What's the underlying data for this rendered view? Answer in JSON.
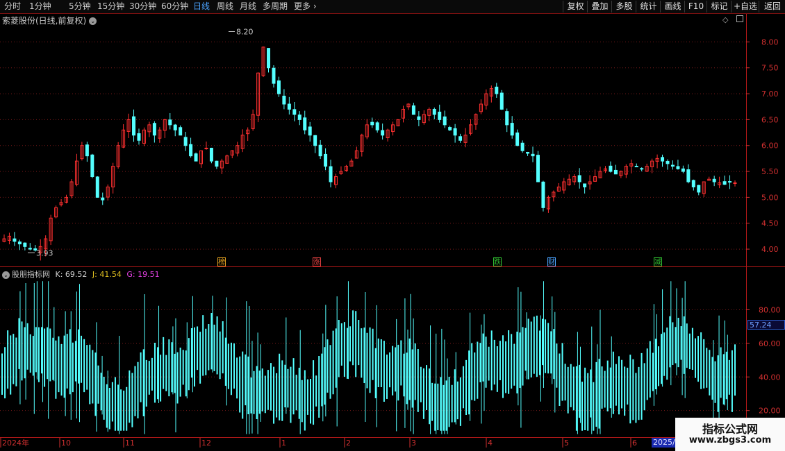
{
  "toolbar": {
    "periods": [
      "分时",
      "1分钟",
      "5分钟",
      "15分钟",
      "30分钟",
      "60分钟",
      "日线",
      "周线",
      "月线",
      "多周期",
      "更多"
    ],
    "active_period": "日线",
    "right_buttons": [
      "复权",
      "叠加",
      "多股",
      "统计",
      "画线",
      "F10",
      "标记",
      "+自选",
      "返回"
    ]
  },
  "chart_title": "索菱股份(日线,前复权)",
  "indicator": {
    "name": "股朋指标网",
    "k_label": "K: 69.52",
    "j_label": "J: 41.54",
    "g_label": "G: 19.51",
    "current_value": "57.24",
    "y_ticks": [
      "80.00",
      "60.00",
      "40.00",
      "20.00"
    ]
  },
  "price_axis": [
    "8.00",
    "7.50",
    "7.00",
    "6.50",
    "6.00",
    "5.50",
    "5.00",
    "4.50",
    "4.00"
  ],
  "price_markers": {
    "high": "8.20",
    "low": "3.93"
  },
  "events": [
    {
      "label": "榜",
      "color": "#e0a020"
    },
    {
      "label": "涨",
      "color": "#e04040"
    },
    {
      "label": "跌",
      "color": "#30c030"
    },
    {
      "label": "财",
      "color": "#4aa3ff"
    },
    {
      "label": "减",
      "color": "#30c030"
    }
  ],
  "time_axis": [
    "2024年",
    "10",
    "11",
    "12",
    "1",
    "2",
    "3",
    "4",
    "5",
    "6",
    "2025/0"
  ],
  "watermark": {
    "line1": "指标公式网",
    "line2": "www.zbgs3.com"
  },
  "colors": {
    "up": "#ff3030",
    "down": "#54ffff",
    "grid": "#7a1a1a",
    "axis": "#d23030",
    "indicator": "#54ffff"
  },
  "chart_data": {
    "type": "candlestick",
    "title": "索菱股份(日线,前复权)",
    "ylim": [
      3.8,
      8.3
    ],
    "close_series": [
      4.2,
      4.25,
      4.15,
      4.1,
      4.05,
      4.0,
      3.98,
      4.05,
      4.2,
      4.6,
      4.8,
      4.9,
      5.0,
      5.3,
      5.7,
      6.0,
      5.8,
      5.4,
      5.0,
      4.95,
      5.2,
      5.6,
      6.0,
      6.3,
      6.5,
      6.2,
      6.1,
      6.3,
      6.4,
      6.2,
      6.3,
      6.5,
      6.4,
      6.3,
      6.2,
      6.0,
      5.8,
      5.7,
      5.9,
      5.95,
      5.7,
      5.6,
      5.7,
      5.8,
      5.9,
      6.0,
      6.2,
      6.3,
      6.6,
      7.4,
      7.9,
      7.5,
      7.2,
      7.0,
      6.8,
      6.7,
      6.6,
      6.5,
      6.3,
      6.2,
      6.0,
      5.8,
      5.6,
      5.3,
      5.4,
      5.5,
      5.6,
      5.7,
      5.9,
      6.2,
      6.4,
      6.4,
      6.3,
      6.2,
      6.3,
      6.4,
      6.5,
      6.7,
      6.8,
      6.6,
      6.5,
      6.6,
      6.7,
      6.6,
      6.5,
      6.4,
      6.3,
      6.2,
      6.1,
      6.2,
      6.4,
      6.6,
      6.8,
      7.0,
      7.1,
      7.0,
      6.7,
      6.4,
      6.2,
      6.0,
      5.9,
      5.85,
      5.8,
      5.3,
      4.8,
      5.0,
      5.1,
      5.2,
      5.3,
      5.35,
      5.4,
      5.3,
      5.2,
      5.3,
      5.4,
      5.5,
      5.55,
      5.5,
      5.45,
      5.5,
      5.6,
      5.65,
      5.6,
      5.55,
      5.6,
      5.7,
      5.75,
      5.7,
      5.65,
      5.6,
      5.55,
      5.5,
      5.3,
      5.2,
      5.1,
      5.3,
      5.35,
      5.3,
      5.28,
      5.25,
      5.3,
      5.28
    ]
  }
}
